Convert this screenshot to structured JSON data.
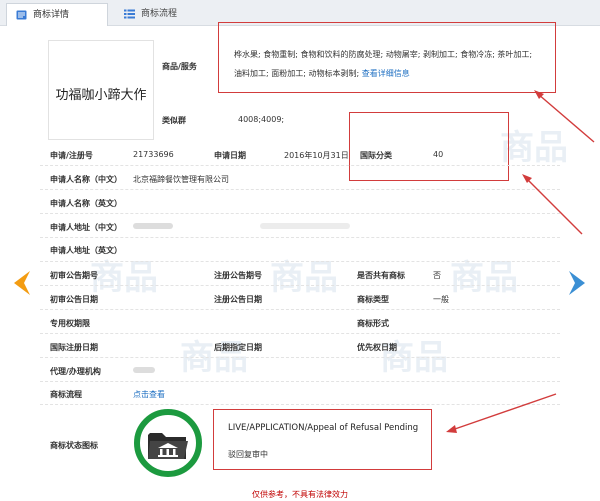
{
  "tabs": [
    {
      "label": "商标详情",
      "icon": "document-icon",
      "active": true
    },
    {
      "label": "商标流程",
      "icon": "list-icon",
      "active": false
    }
  ],
  "logo": {
    "text": "功福咖小蹄大作"
  },
  "fields": {
    "goods_label": "商品/服务",
    "goods_line1": "桦水果; 食物重制; 食物和饮料的防腐处理; 动物屠宰; 剥制加工; 食物冷冻; 茶叶加工;",
    "goods_line2": "油料加工; 面粉加工; 动物标本剥制;",
    "goods_more": "查看详细信息",
    "group_label": "类似群",
    "group_value": "4008;4009;",
    "regno_label": "申请/注册号",
    "regno_value": "21733696",
    "appdate_label": "申请日期",
    "appdate_value": "2016年10月31日",
    "intl_class_label": "国际分类",
    "intl_class_value": "40",
    "applicant_cn_label": "申请人名称（中文）",
    "applicant_cn_value": "北京福蹄餐饮管理有限公司",
    "applicant_en_label": "申请人名称（英文）",
    "addr_cn_label": "申请人地址（中文）",
    "addr_en_label": "申请人地址（英文）",
    "prelim_no_label": "初审公告期号",
    "reg_no_label": "注册公告期号",
    "shared_label": "是否共有商标",
    "shared_value": "否",
    "prelim_date_label": "初审公告日期",
    "reg_date_label": "注册公告日期",
    "tm_type_label": "商标类型",
    "tm_type_value": "一般",
    "exclusive_label": "专用权期限",
    "tm_form_label": "商标形式",
    "intl_reg_date_label": "国际注册日期",
    "later_date_label": "后期指定日期",
    "priority_date_label": "优先权日期",
    "agent_label": "代理/办理机构",
    "process_label": "商标流程",
    "process_link": "点击查看",
    "status_label": "商标状态图标",
    "status_en": "LIVE/APPLICATION/Appeal of Refusal Pending",
    "status_cn": "驳回复审中"
  },
  "footer": {
    "text": "仅供参考，不具有法律效力"
  },
  "colors": {
    "accent_red": "#d23c3c",
    "status_green": "#1c9a3f",
    "link_blue": "#1e6fc2",
    "nav_orange": "#f39c12",
    "nav_blue": "#3b8fd4"
  },
  "watermark": {
    "text": "商品"
  }
}
